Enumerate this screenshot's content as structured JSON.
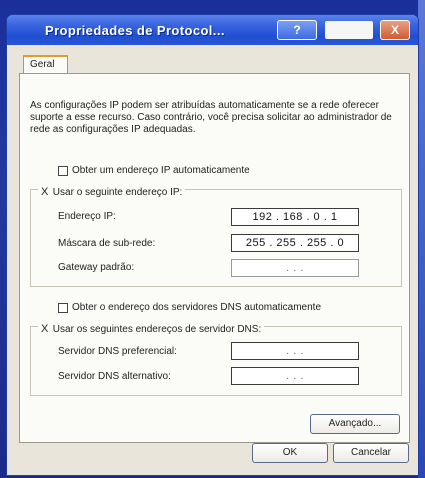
{
  "window": {
    "title": "Propriedades de Protocol...",
    "help_label": "?",
    "close_label": "X"
  },
  "tabs": {
    "general": "Geral"
  },
  "description": "As configurações IP podem ser atribuídas automaticamente se a rede oferecer suporte a esse recurso. Caso contrário, você precisa solicitar ao administrador de rede as configurações IP adequadas.",
  "ip": {
    "auto_label": "Obter um endereço IP automaticamente",
    "auto_checked": false,
    "manual_label": "Usar o seguinte endereço IP:",
    "manual_checked": true,
    "manual_mark": "X",
    "address_label": "Endereço IP:",
    "address_value": "192 . 168 . 0 . 1",
    "mask_label": "Máscara de sub-rede:",
    "mask_value": "255 . 255 . 255 . 0",
    "gateway_label": "Gateway padrão:",
    "gateway_value": ". . ."
  },
  "dns": {
    "auto_label": "Obter o endereço dos servidores DNS automaticamente",
    "auto_checked": false,
    "manual_label": "Usar os seguintes endereços de servidor DNS:",
    "manual_checked": true,
    "manual_mark": "X",
    "preferred_label": "Servidor DNS preferencial:",
    "preferred_value": ". . .",
    "alternate_label": "Servidor DNS alternativo:",
    "alternate_value": ". . ."
  },
  "buttons": {
    "advanced": "Avançado...",
    "ok": "OK",
    "cancel": "Cancelar"
  }
}
